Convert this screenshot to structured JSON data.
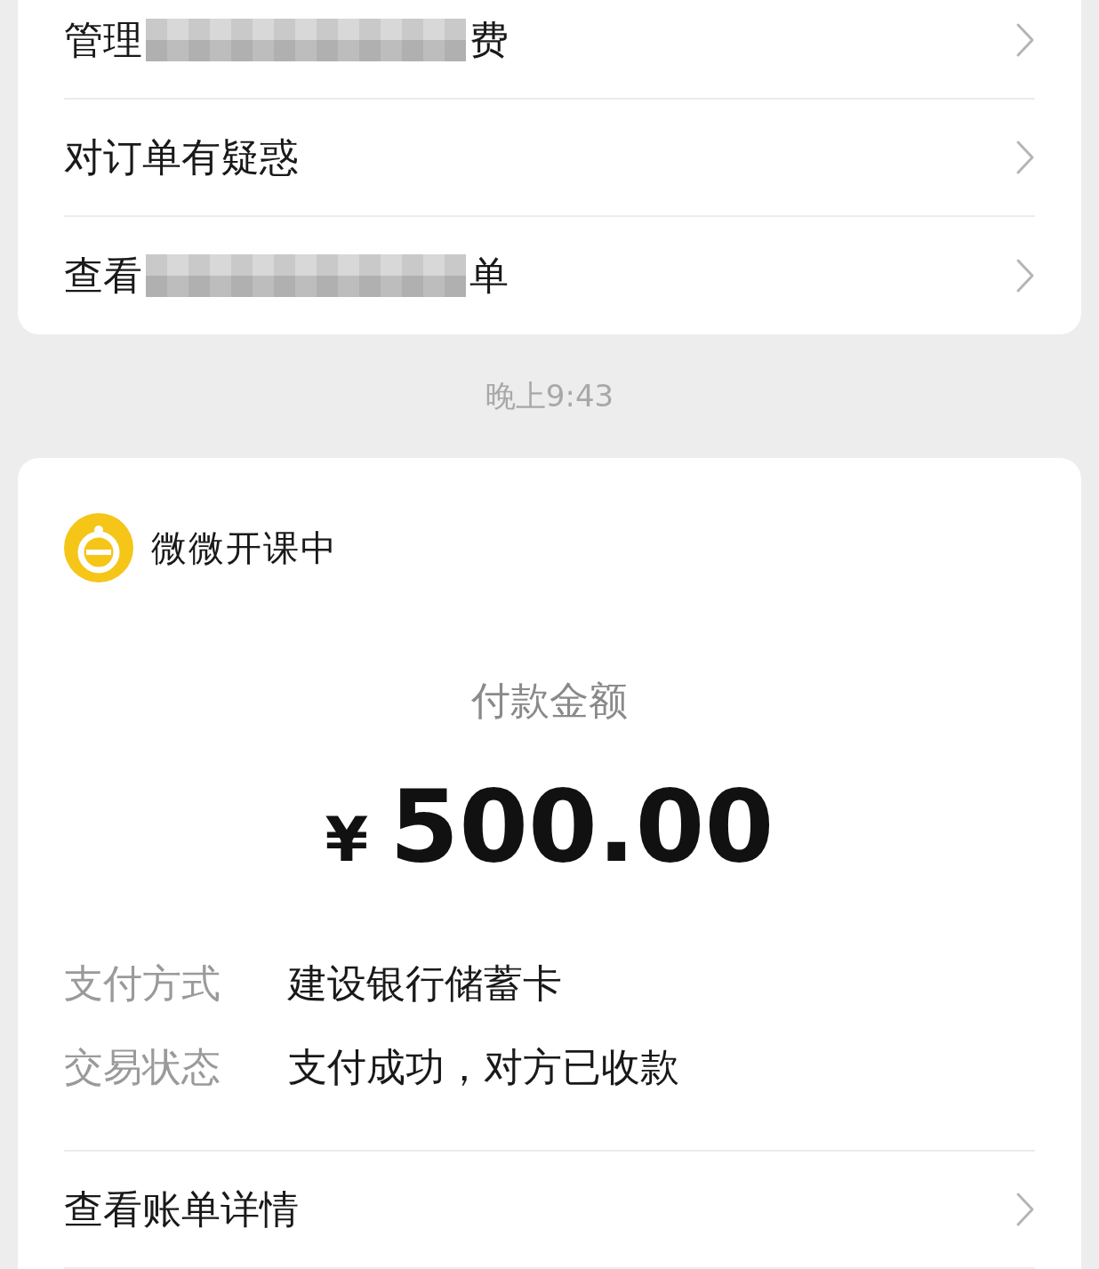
{
  "menu": [
    {
      "text_before": "管理",
      "text_after": "费",
      "redacted": true
    },
    {
      "text_before": "对订单有疑惑",
      "redacted": false
    },
    {
      "text_before": "查看",
      "text_after": "单",
      "redacted": true
    }
  ],
  "time": "晚上9:43",
  "payment": {
    "merchant": "微微开课中",
    "amount_label": "付款金额",
    "currency": "¥",
    "amount": "500.00",
    "details": [
      {
        "label": "支付方式",
        "value": "建设银行储蓄卡"
      },
      {
        "label": "交易状态",
        "value": "支付成功，对方已收款"
      }
    ],
    "link": "查看账单详情"
  }
}
